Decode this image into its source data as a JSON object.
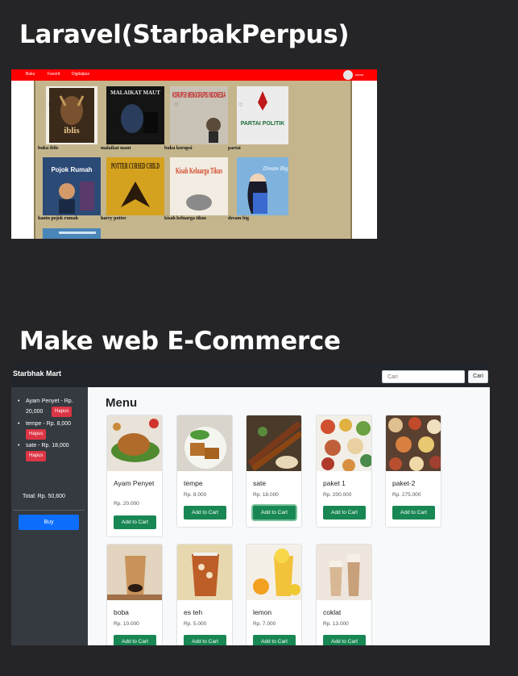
{
  "headings": {
    "laravel": "Laravel(StarbakPerpus)",
    "ecommerce": "Make web E-Commerce"
  },
  "laravel_app": {
    "nav_items": [
      "Buku",
      "Favorit",
      "Digitalpus"
    ],
    "user": "nama",
    "books": [
      {
        "title": "buku iblis",
        "cover_text": "iblis",
        "cover_color": "#3b2a1a"
      },
      {
        "title": "malaikat maut",
        "cover_text": "MALAIKAT MAUT",
        "cover_color": "#141414"
      },
      {
        "title": "buku korupsi",
        "cover_text": "KORUPSI! MENGORUPSI INDONESIA",
        "cover_color": "#c9c2b6"
      },
      {
        "title": "partai",
        "cover_text": "PARTAI POLITIK",
        "cover_color": "#ececec"
      },
      {
        "title": "hantu pojok rumah",
        "cover_text": "Pojok Rumah",
        "cover_color": "#2c4a76"
      },
      {
        "title": "harry potter",
        "cover_text": "POTTER CURSED CHILD",
        "cover_color": "#d4a21f"
      },
      {
        "title": "kisah keluarga tikus",
        "cover_text": "Kisah Keluarga Tikus",
        "cover_color": "#f2ece2"
      },
      {
        "title": "dream big",
        "cover_text": "Dream Big",
        "cover_color": "#7fb3de"
      }
    ]
  },
  "shop": {
    "brand": "Starbhak Mart",
    "search": {
      "placeholder": "Cari",
      "button": "Cari"
    },
    "cart": [
      {
        "label": "Ayam Penyet - Rp. 20,000",
        "remove": "Hapus"
      },
      {
        "label": "tempe - Rp. 8,000",
        "remove": "Hapus"
      },
      {
        "label": "sate - Rp. 18,000",
        "remove": "Hapus"
      }
    ],
    "total": "Total: Rp. 50,600",
    "buy": "Buy",
    "menu_title": "Menu",
    "add_to_cart": "Add to Cart",
    "products": [
      {
        "name": "Ayam Penyet",
        "price": "Rp. 20.000"
      },
      {
        "name": "tempe",
        "price": "Rp. 8.000"
      },
      {
        "name": "sate",
        "price": "Rp. 18.000"
      },
      {
        "name": "paket 1",
        "price": "Rp. 200.000"
      },
      {
        "name": "paket-2",
        "price": "Rp. 275.000"
      },
      {
        "name": "boba",
        "price": "Rp. 10.000"
      },
      {
        "name": "es teh",
        "price": "Rp. 5.000"
      },
      {
        "name": "lemon",
        "price": "Rp. 7.000"
      },
      {
        "name": "coklat",
        "price": "Rp. 13.000"
      }
    ]
  }
}
